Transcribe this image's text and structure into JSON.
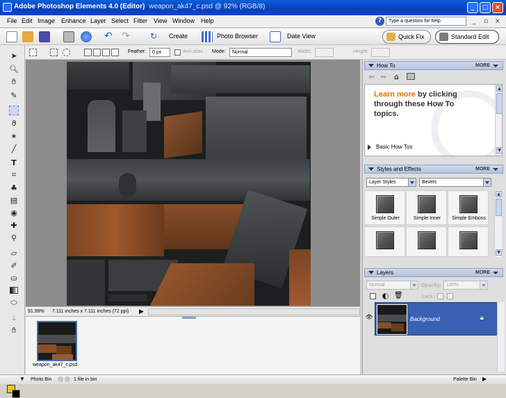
{
  "titlebar": {
    "app": "Adobe Photoshop Elements 4.0 (Editor)",
    "file": "weapon_ak47_c.psd @ 92% (RGB/8)"
  },
  "menu": [
    "File",
    "Edit",
    "Image",
    "Enhance",
    "Layer",
    "Select",
    "Filter",
    "View",
    "Window",
    "Help"
  ],
  "help": {
    "placeholder": "Type a question for help"
  },
  "toolbar": {
    "create": "Create",
    "photo_browser": "Photo Browser",
    "date_view": "Date View",
    "quick_fix": "Quick Fix",
    "standard_edit": "Standard Edit"
  },
  "options": {
    "feather_label": "Feather:",
    "feather_value": "0 px",
    "antialias": "Anti-alias",
    "mode_label": "Mode:",
    "mode_value": "Normal",
    "width_label": "Width:",
    "height_label": "Height:"
  },
  "status": {
    "zoom": "91.99%",
    "docinfo": "7.111 inches x 7.111 inches (72 ppi)"
  },
  "photobin": {
    "thumb_label": "weapon_ak47_c.psd"
  },
  "bottombar": {
    "photo_bin": "Photo Bin",
    "count": "1 file in bin",
    "palette_bin": "Palette Bin"
  },
  "howto": {
    "title": "How To",
    "more": "MORE",
    "learn": "Learn more",
    "rest": " by clicking through these How To topics.",
    "link": "Basic How Tos"
  },
  "styles": {
    "title": "Styles and Effects",
    "more": "MORE",
    "category": "Layer Styles",
    "subcategory": "Bevels",
    "items": [
      "Simple Outer",
      "Simple Inner",
      "Simple Emboss"
    ]
  },
  "layers": {
    "title": "Layers",
    "more": "MORE",
    "blend": "Normal",
    "opacity_label": "Opacity:",
    "opacity_value": "100%",
    "lock_label": "Lock:",
    "layer_name": "Background"
  }
}
